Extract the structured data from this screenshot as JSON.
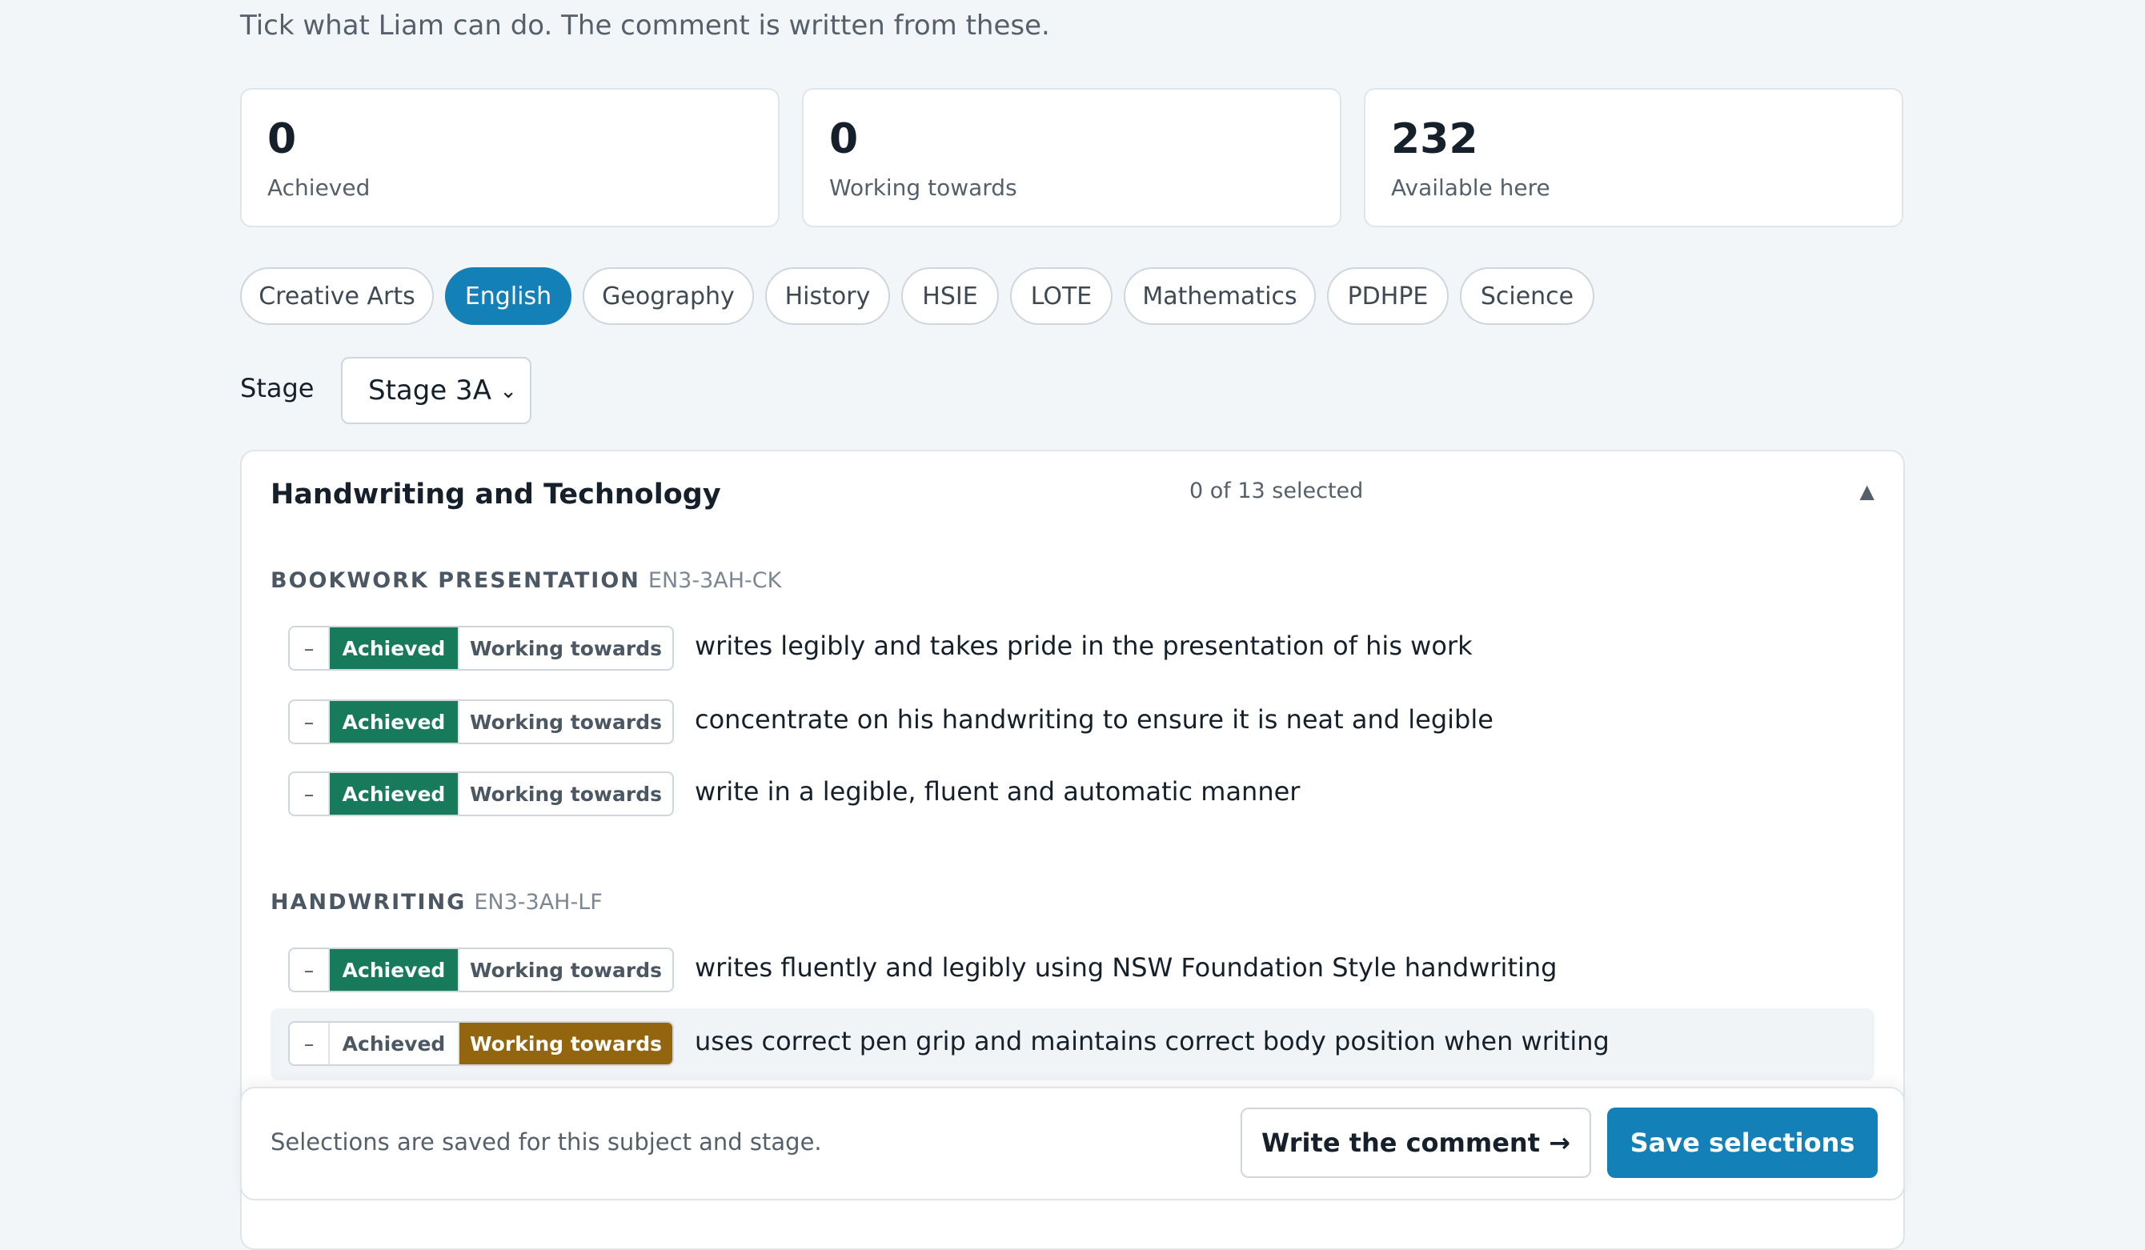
{
  "intro": "Tick what Liam can do. The comment is written from these.",
  "stats": [
    {
      "value": "0",
      "label": "Achieved"
    },
    {
      "value": "0",
      "label": "Working towards"
    },
    {
      "value": "232",
      "label": "Available here"
    }
  ],
  "tabs": [
    "Creative Arts",
    "English",
    "Geography",
    "History",
    "HSIE",
    "LOTE",
    "Mathematics",
    "PDHPE",
    "Science"
  ],
  "active_tab": "English",
  "stage": {
    "label": "Stage",
    "selected": "Stage 3A"
  },
  "section": {
    "title": "Handwriting and Technology",
    "count_text": "0 of 13 selected",
    "collapse_icon": "caret-up-icon",
    "groups": [
      {
        "name": "BOOKWORK PRESENTATION",
        "code": "EN3-3AH-CK",
        "items": [
          {
            "text": "writes legibly and takes pride in the presentation of his work",
            "state": "achieved"
          },
          {
            "text": "concentrate on his handwriting to ensure it is neat and legible",
            "state": "achieved"
          },
          {
            "text": "write in a legible, fluent and automatic manner",
            "state": "achieved"
          }
        ]
      },
      {
        "name": "HANDWRITING",
        "code": "EN3-3AH-LF",
        "items": [
          {
            "text": "writes fluently and legibly using NSW Foundation Style handwriting",
            "state": "achieved"
          },
          {
            "text": "uses correct pen grip and maintains correct body position when writing",
            "state": "working"
          }
        ]
      }
    ]
  },
  "segment_labels": {
    "none": "–",
    "achieved": "Achieved",
    "working": "Working towards"
  },
  "footer": {
    "note": "Selections are saved for this subject and stage.",
    "write_label": "Write the comment →",
    "save_label": "Save selections"
  },
  "colors": {
    "accent": "#1480b8",
    "achieved": "#177a5a",
    "working": "#94650f"
  }
}
